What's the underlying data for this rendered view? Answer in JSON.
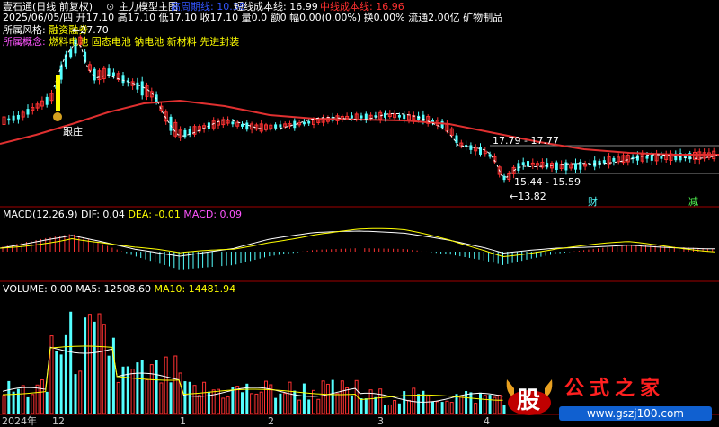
{
  "header": {
    "app": "壹石通(日线 前复权)",
    "mode_icon": "circle-icon",
    "template": "主力模型主图",
    "highlight_label": "高周期线: 10.38",
    "short_cost_label": "短线成本线: 16.99",
    "mid_cost_label": "中线成本线: 16.96"
  },
  "info_line": {
    "date": "2025/06/05/四",
    "open": "开17.10",
    "high": "高17.10",
    "low": "低17.10",
    "close": "收17.10",
    "volume": "量0.0",
    "amount": "额0",
    "change": "幅0.00(0.00%)",
    "turnover": "换0.00%",
    "float_cap": "流通2.00亿",
    "industry": "矿物制品"
  },
  "tags": {
    "style_label": "所属风格:",
    "style_value": "融资融券",
    "concept_label": "所属概念:",
    "concept_value": "燃料电池 固态电池 钠电池 新材料 先进封装"
  },
  "annotations": {
    "peak": "←27.70",
    "follow": "跟庄",
    "range_high": "17.79 - 17.77",
    "range_low": "15.44 - 15.59",
    "low": "←13.82",
    "event_cai": "财",
    "event_jian": "减"
  },
  "macd": {
    "title": "MACD(12,26,9)",
    "dif": "DIF: 0.04",
    "dea": "DEA: -0.01",
    "macd": "MACD: 0.09"
  },
  "volume": {
    "title": "VOLUME: 0.00",
    "ma5": "MA5: 12508.60",
    "ma10": "MA10: 14481.94"
  },
  "x_axis": [
    "2024年",
    "12",
    "1",
    "2",
    "3",
    "4"
  ],
  "watermark": {
    "logo_char": "股",
    "site_name": "公式之家",
    "url": "www.gszj100.com"
  },
  "colors": {
    "up": "#ff3232",
    "down": "#54ffff",
    "ma_red": "#e03030",
    "white_line": "#ffffff",
    "yellow": "#ffff00",
    "magenta": "#ff00ff",
    "blue": "#4060ff"
  }
}
